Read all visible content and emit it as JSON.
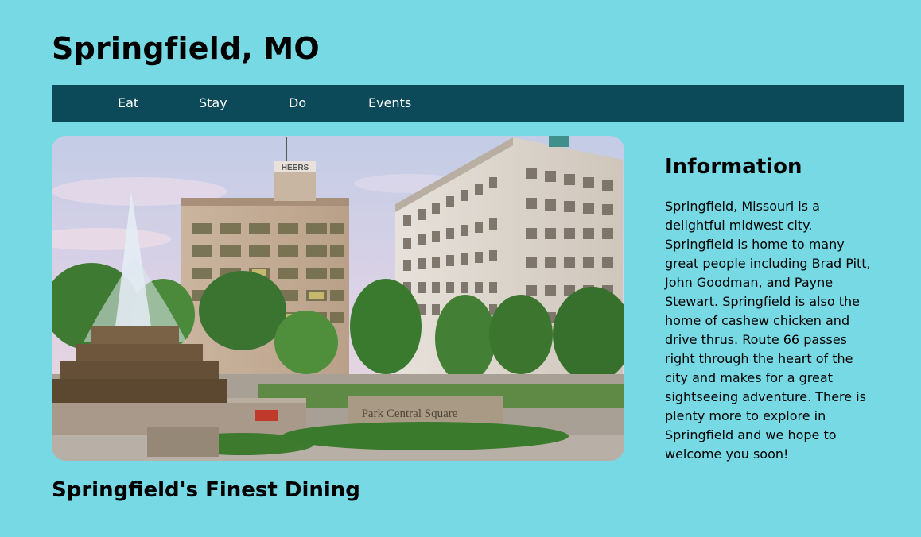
{
  "header": {
    "title": "Springfield, MO"
  },
  "nav": {
    "items": [
      {
        "label": "Eat"
      },
      {
        "label": "Stay"
      },
      {
        "label": "Do"
      },
      {
        "label": "Events"
      }
    ]
  },
  "hero": {
    "image_sign_text": "Park Central Square",
    "building_sign_text": "HEERS"
  },
  "main": {
    "section_heading": "Springfield's Finest Dining"
  },
  "info": {
    "title": "Information",
    "body": "Springfield, Missouri is a delightful midwest city. Springfield is home to many great people including Brad Pitt, John Goodman, and Payne Stewart. Springfield is also the home of cashew chicken and drive thrus. Route 66 passes right through the heart of the city and makes for a great sightseeing adventure. There is plenty more to explore in Springfield and we hope to welcome you soon!"
  },
  "colors": {
    "page_background": "#76d9e4",
    "nav_background": "#0c4a5a",
    "nav_text": "#ffffff"
  }
}
